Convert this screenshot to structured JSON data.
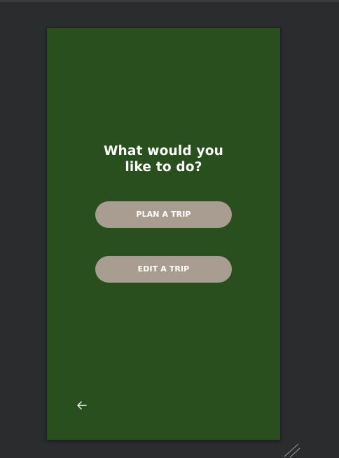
{
  "screen": {
    "question_line1": "What would you",
    "question_line2": "like to do?"
  },
  "actions": {
    "plan_label": "PLAN A TRIP",
    "edit_label": "EDIT A TRIP"
  },
  "navigation": {
    "back_icon": "arrow-left-icon"
  },
  "colors": {
    "workspace_bg": "#2b2c2e",
    "screen_bg": "#2a4f1f",
    "button_bg": "#a99d91",
    "text": "#ffffff"
  }
}
